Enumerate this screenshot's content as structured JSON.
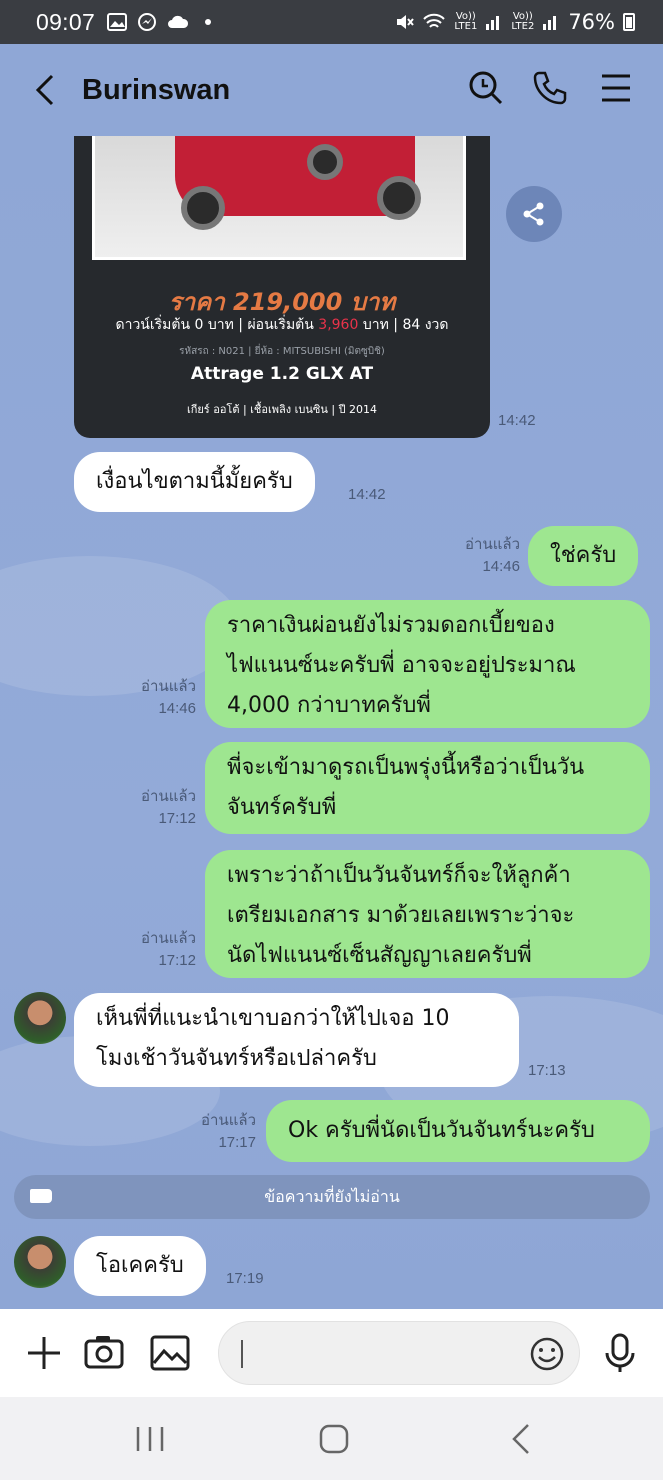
{
  "statusbar": {
    "time": "09:07",
    "battery": "76%",
    "net1": "LTE1",
    "net2": "LTE2",
    "volte": "Vo))"
  },
  "header": {
    "title": "Burinswan"
  },
  "image_card": {
    "price": "ราคา 219,000 บาท",
    "down_pre": "ดาวน์เริ่มต้น 0 บาท | ผ่อนเริ่มต้น",
    "down_red": "3,960",
    "down_post": "บาท | 84 งวด",
    "codes": "รหัสรถ : N021 | ยี่ห้อ : MITSUBISHI (มิตซูบิชิ)",
    "model": "Attrage 1.2 GLX AT",
    "specs": "เกียร์ ออโต้ | เชื้อเพลิง เบนซิน | ปี 2014",
    "time": "14:42"
  },
  "messages": [
    {
      "dir": "in",
      "text": "เงื่อนไขตามนี้มั้ยครับ",
      "time": "14:42"
    },
    {
      "dir": "out",
      "read": "อ่านแล้ว",
      "text": "ใช่ครับ",
      "time": "14:46"
    },
    {
      "dir": "out",
      "read": "อ่านแล้ว",
      "lines": [
        "ราคาเงินผ่อนยังไม่รวมดอกเบี้ยของ",
        "ไฟแนนซ์นะครับพี่ อาจจะอยู่ประมาณ",
        "4,000 กว่าบาทครับพี่"
      ],
      "time": "14:46"
    },
    {
      "dir": "out",
      "read": "อ่านแล้ว",
      "lines": [
        "พี่จะเข้ามาดูรถเป็นพรุ่งนี้หรือว่าเป็นวัน",
        "จันทร์ครับพี่"
      ],
      "time": "17:12"
    },
    {
      "dir": "out",
      "read": "อ่านแล้ว",
      "lines": [
        "เพราะว่าถ้าเป็นวันจันทร์ก็จะให้ลูกค้า",
        "เตรียมเอกสาร มาด้วยเลยเพราะว่าจะ",
        "นัดไฟแนนซ์เซ็นสัญญาเลยครับพี่"
      ],
      "time": "17:12"
    },
    {
      "dir": "in",
      "lines": [
        "เห็นพี่ที่แนะนำเขาบอกว่าให้ไปเจอ 10",
        "โมงเช้าวันจันทร์หรือเปล่าครับ"
      ],
      "time": "17:13"
    },
    {
      "dir": "out",
      "read": "อ่านแล้ว",
      "text": "Ok ครับพี่นัดเป็นวันจันทร์นะครับ",
      "time": "17:17"
    },
    {
      "dir": "in",
      "text": "โอเคครับ",
      "time": "17:19"
    }
  ],
  "unread_divider": "ข้อความที่ยังไม่อ่าน",
  "colors": {
    "chat_bg": "#8fa7d6",
    "out_bubble": "#9ee690",
    "in_bubble": "#ffffff",
    "status_bar": "#3a3d42"
  }
}
